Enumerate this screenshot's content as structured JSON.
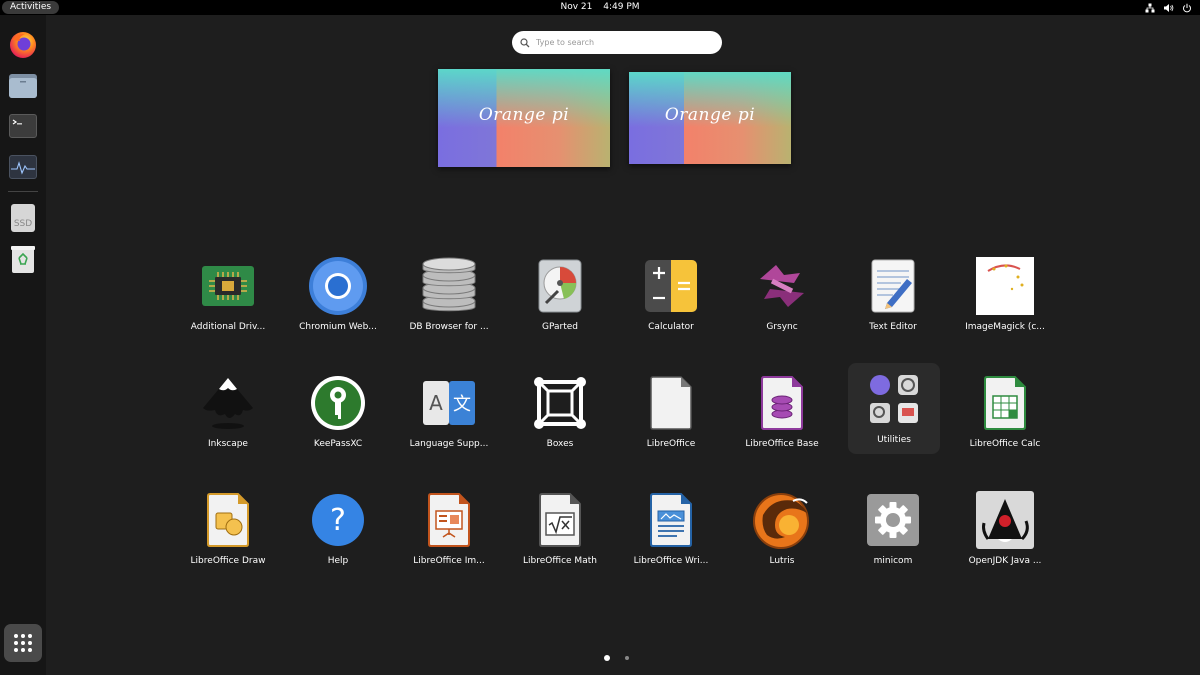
{
  "topbar": {
    "activities_label": "Activities",
    "date": "Nov 21",
    "time": "4:49 PM",
    "tray_icons": [
      "network-icon",
      "volume-icon",
      "power-icon"
    ]
  },
  "dock": {
    "items": [
      {
        "name": "firefox",
        "icon": "firefox-icon"
      },
      {
        "name": "files",
        "icon": "folder-icon"
      },
      {
        "name": "terminal",
        "icon": "terminal-icon"
      },
      {
        "name": "system-monitor",
        "icon": "monitor-icon"
      },
      {
        "name": "ssd-drive",
        "icon": "drive-icon",
        "label": "SSD"
      },
      {
        "name": "trash",
        "icon": "trash-icon"
      }
    ],
    "show_apps_icon": "grid-icon"
  },
  "search": {
    "placeholder": "Type to search"
  },
  "workspaces": [
    {
      "logo_text": "Orange pi"
    },
    {
      "logo_text": "Orange pi"
    }
  ],
  "apps": [
    {
      "label": "Additional Driv...",
      "icon": "chip-icon"
    },
    {
      "label": "Chromium Web...",
      "icon": "chromium-icon"
    },
    {
      "label": "DB Browser for ...",
      "icon": "database-icon"
    },
    {
      "label": "GParted",
      "icon": "gparted-icon"
    },
    {
      "label": "Calculator",
      "icon": "calculator-icon"
    },
    {
      "label": "Grsync",
      "icon": "grsync-icon"
    },
    {
      "label": "Text Editor",
      "icon": "text-editor-icon"
    },
    {
      "label": "ImageMagick (c...",
      "icon": "imagemagick-icon"
    },
    {
      "label": "Inkscape",
      "icon": "inkscape-icon"
    },
    {
      "label": "KeePassXC",
      "icon": "keepass-icon"
    },
    {
      "label": "Language Supp...",
      "icon": "language-icon"
    },
    {
      "label": "Boxes",
      "icon": "boxes-icon"
    },
    {
      "label": "LibreOffice",
      "icon": "libreoffice-icon"
    },
    {
      "label": "LibreOffice Base",
      "icon": "lo-base-icon"
    },
    {
      "label": "Utilities",
      "icon": "folder-utilities-icon"
    },
    {
      "label": "LibreOffice Calc",
      "icon": "lo-calc-icon"
    },
    {
      "label": "LibreOffice Draw",
      "icon": "lo-draw-icon"
    },
    {
      "label": "Help",
      "icon": "help-icon"
    },
    {
      "label": "LibreOffice Im...",
      "icon": "lo-impress-icon"
    },
    {
      "label": "LibreOffice Math",
      "icon": "lo-math-icon"
    },
    {
      "label": "LibreOffice Wri...",
      "icon": "lo-writer-icon"
    },
    {
      "label": "Lutris",
      "icon": "lutris-icon"
    },
    {
      "label": "minicom",
      "icon": "gear-icon"
    },
    {
      "label": "OpenJDK Java ...",
      "icon": "java-duke-icon"
    }
  ],
  "pagination": {
    "current": 1,
    "total": 2
  },
  "colors": {
    "background": "#1e1e1e",
    "dock": "#161616",
    "topbar": "#000000"
  }
}
